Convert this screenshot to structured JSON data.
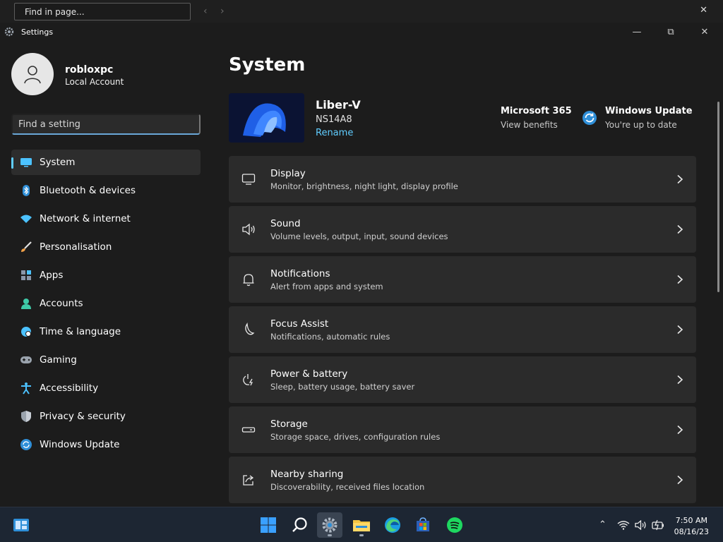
{
  "findbar": {
    "placeholder": "Find in page..."
  },
  "window": {
    "title": "Settings"
  },
  "profile": {
    "name": "robloxpc",
    "account_type": "Local Account"
  },
  "search": {
    "placeholder": "Find a setting"
  },
  "nav": {
    "items": [
      {
        "label": "System"
      },
      {
        "label": "Bluetooth & devices"
      },
      {
        "label": "Network & internet"
      },
      {
        "label": "Personalisation"
      },
      {
        "label": "Apps"
      },
      {
        "label": "Accounts"
      },
      {
        "label": "Time & language"
      },
      {
        "label": "Gaming"
      },
      {
        "label": "Accessibility"
      },
      {
        "label": "Privacy & security"
      },
      {
        "label": "Windows Update"
      }
    ]
  },
  "main": {
    "title": "System",
    "device": {
      "name": "Liber-V",
      "model": "NS14A8",
      "rename": "Rename"
    },
    "ms365": {
      "title": "Microsoft 365",
      "subtitle": "View benefits"
    },
    "update": {
      "title": "Windows Update",
      "subtitle": "You're up to date"
    },
    "cards": [
      {
        "title": "Display",
        "subtitle": "Monitor, brightness, night light, display profile",
        "icon": "monitor-icon"
      },
      {
        "title": "Sound",
        "subtitle": "Volume levels, output, input, sound devices",
        "icon": "speaker-icon"
      },
      {
        "title": "Notifications",
        "subtitle": "Alert from apps and system",
        "icon": "bell-icon"
      },
      {
        "title": "Focus Assist",
        "subtitle": "Notifications, automatic rules",
        "icon": "moon-icon"
      },
      {
        "title": "Power & battery",
        "subtitle": "Sleep, battery usage, battery saver",
        "icon": "power-icon"
      },
      {
        "title": "Storage",
        "subtitle": "Storage space, drives, configuration rules",
        "icon": "drive-icon"
      },
      {
        "title": "Nearby sharing",
        "subtitle": "Discoverability, received files location",
        "icon": "share-icon"
      }
    ]
  },
  "taskbar": {
    "time": "7:50 AM",
    "date": "08/16/23"
  },
  "colors": {
    "accent": "#60cdff",
    "card": "#2b2b2b",
    "background": "#1c1c1c",
    "taskbar": "#1d2633"
  }
}
